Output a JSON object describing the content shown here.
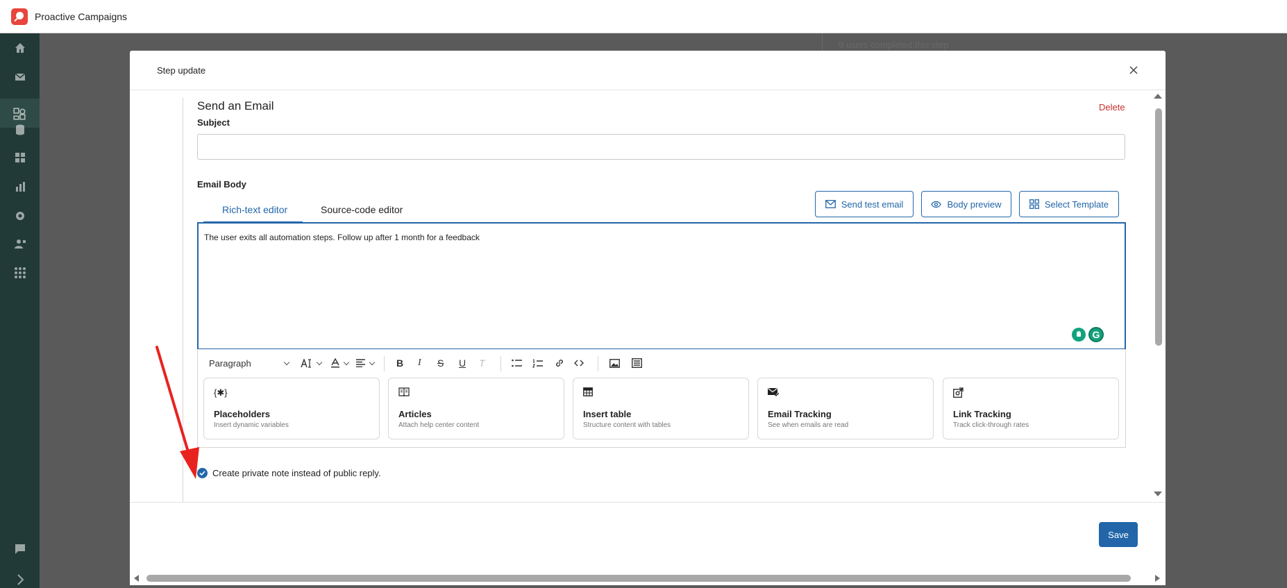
{
  "app": {
    "title": "Proactive Campaigns"
  },
  "background": {
    "status_text": "9 users completed this step"
  },
  "sidebar": {
    "items": [
      {
        "name": "home-icon"
      },
      {
        "name": "mail-icon"
      },
      {
        "name": "campaigns-icon",
        "active": true
      },
      {
        "name": "database-icon"
      },
      {
        "name": "widgets-icon"
      },
      {
        "name": "reports-icon"
      },
      {
        "name": "settings-icon"
      },
      {
        "name": "users-icon"
      },
      {
        "name": "apps-icon"
      },
      {
        "name": "chat-icon"
      },
      {
        "name": "expand-icon"
      }
    ]
  },
  "modal": {
    "title": "Step update",
    "section_title": "Send an Email",
    "delete_label": "Delete",
    "subject_label": "Subject",
    "subject_value": "",
    "email_body_label": "Email Body",
    "tabs": [
      {
        "label": "Rich-text editor",
        "active": true
      },
      {
        "label": "Source-code editor",
        "active": false
      }
    ],
    "buttons": {
      "send_test_email": "Send test email",
      "body_preview": "Body preview",
      "select_template": "Select Template"
    },
    "editor_text": "The user exits all automation steps. Follow up after 1 month for a feedback",
    "toolbar": {
      "paragraph": "Paragraph"
    },
    "cards": [
      {
        "icon": "placeholders-icon",
        "glyph": "{✱}",
        "title": "Placeholders",
        "subtitle": "Insert dynamic variables"
      },
      {
        "icon": "articles-icon",
        "glyph": "",
        "title": "Articles",
        "subtitle": "Attach help center content"
      },
      {
        "icon": "table-icon",
        "glyph": "",
        "title": "Insert table",
        "subtitle": "Structure content with tables"
      },
      {
        "icon": "email-tracking-icon",
        "glyph": "",
        "title": "Email Tracking",
        "subtitle": "See when emails are read"
      },
      {
        "icon": "link-tracking-icon",
        "glyph": "",
        "title": "Link Tracking",
        "subtitle": "Track click-through rates"
      }
    ],
    "private_note": {
      "label": "Create private note instead of public reply.",
      "checked": true
    },
    "save_label": "Save"
  },
  "colors": {
    "accent": "#2266a9",
    "danger": "#c8302f",
    "sidebar": "#223a37",
    "annotation": "#e8231f"
  }
}
